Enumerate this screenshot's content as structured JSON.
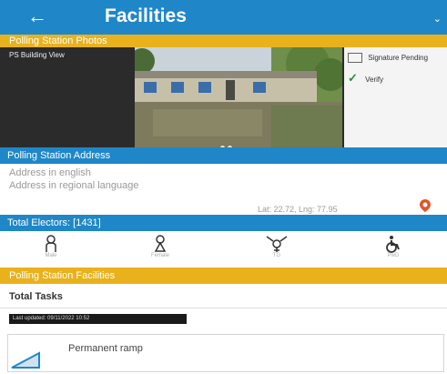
{
  "header": {
    "back_icon": "arrow-left-icon",
    "title": "Facilities"
  },
  "photos_section": {
    "title": "Polling Station Photos",
    "caption": "PS Building View"
  },
  "verification": {
    "items": [
      {
        "label": "Signature Pending"
      },
      {
        "label": "Verify"
      }
    ]
  },
  "address_section": {
    "title": "Polling Station Address",
    "english": "Address in english",
    "regional": "Address in regional language",
    "coords": "Lat: 22.72, Lng: 77.95"
  },
  "electors": {
    "title": "Total Electors: [1431]",
    "items": [
      {
        "icon": "male-elector-icon",
        "label": "Male"
      },
      {
        "icon": "female-elector-icon",
        "label": "Female"
      },
      {
        "icon": "third-gender-icon",
        "label": "TG"
      },
      {
        "icon": "wheelchair-icon",
        "label": "PwD"
      }
    ]
  },
  "facilities_section": {
    "title": "Polling Station Facilities"
  },
  "tasks": {
    "title": "Total Tasks"
  },
  "stamp": {
    "text": "Last updated: 09/11/2022 10:52"
  },
  "facility_card": {
    "label": "Permanent ramp",
    "icon": "ramp-icon"
  },
  "colors": {
    "appbar": "#1f87c8",
    "section_band_yellow": "#e9b21c",
    "section_band_blue": "#1f87c8",
    "verify_check": "#2e8b3e",
    "pin": "#e2552a"
  }
}
